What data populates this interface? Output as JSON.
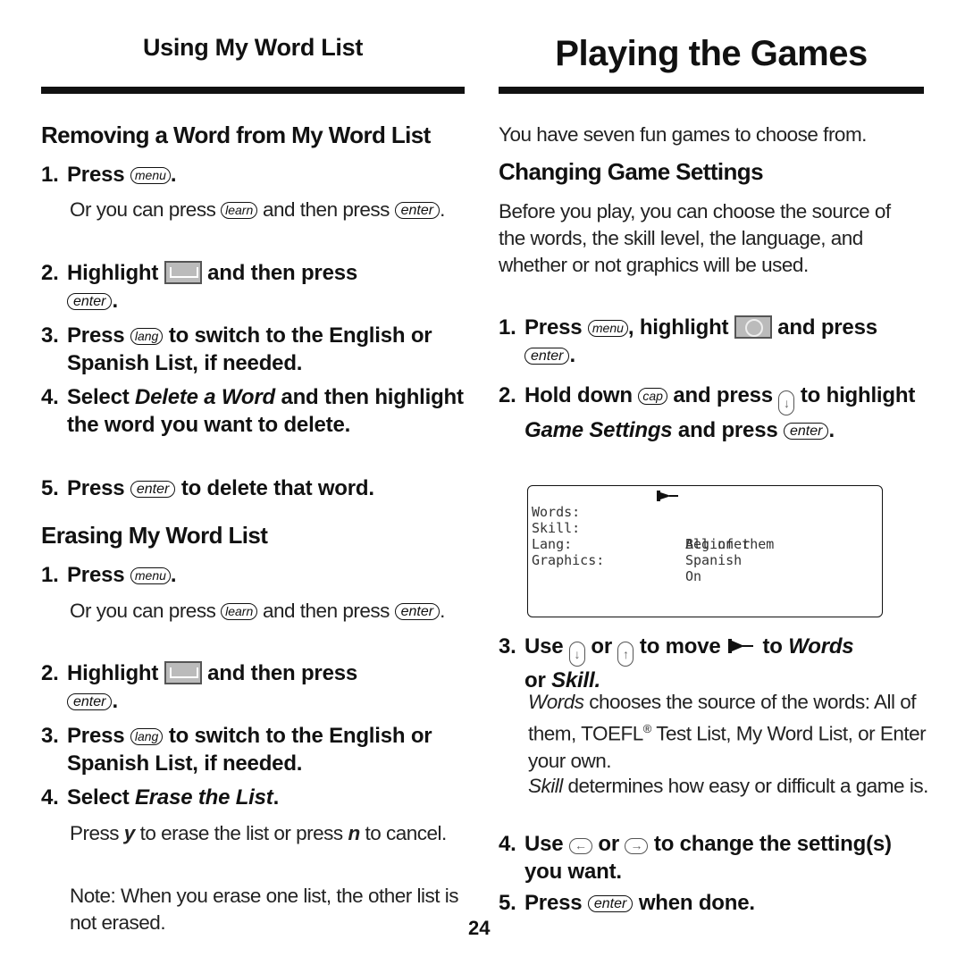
{
  "left": {
    "header": "Using My Word List",
    "section1": {
      "title": "Removing a Word from My Word List",
      "steps": [
        {
          "num": "1.",
          "pre": "Press",
          "key": "menu",
          "post": "."
        },
        {
          "note_pre": "Or you can press",
          "note_key": "learn",
          "note_mid": "and then press",
          "note_key2": "enter",
          "note_post": "."
        },
        {
          "num": "2.",
          "pre": "Highlight",
          "icon": "word-list-icon",
          "mid": "and then press",
          "key": "enter",
          "post": "."
        },
        {
          "num": "3.",
          "pre": "Press",
          "key": "lang",
          "post": "to switch to the English or Spanish List, if needed."
        },
        {
          "num": "4.",
          "pre": "Select",
          "em": "Delete a Word",
          "post": "and then highlight the word you want to delete."
        },
        {
          "num": "5.",
          "pre": "Press",
          "key": "enter",
          "post": "to delete that word."
        }
      ]
    },
    "section2": {
      "title": "Erasing My Word List",
      "steps": [
        {
          "num": "1.",
          "pre": "Press",
          "key": "menu",
          "post": "."
        },
        {
          "note_pre": "Or you can press",
          "note_key": "learn",
          "note_mid": "and then press",
          "note_key2": "enter",
          "note_post": "."
        },
        {
          "num": "2.",
          "pre": "Highlight",
          "icon": "word-list-icon",
          "mid": "and then press",
          "key": "enter",
          "post": "."
        },
        {
          "num": "3.",
          "pre": "Press",
          "key": "lang",
          "post": "to switch to the English or Spanish List, if needed."
        },
        {
          "num": "4.",
          "pre": "Select",
          "em": "Erase the List",
          "post": "."
        }
      ],
      "note1": {
        "pre": "Press",
        "y": "y",
        "mid": "to erase the list or press",
        "n": "n",
        "post": "to cancel."
      },
      "note2": "Note: When you erase one list, the other list is not erased."
    }
  },
  "right": {
    "header": "Playing the Games",
    "intro": "You have seven fun games to choose from.",
    "section": {
      "title": "Changing Game Settings",
      "body": "Before you play, you can choose the source of the words, the skill level, the language, and whether or not graphics will be used.",
      "steps": [
        {
          "num": "1.",
          "pre": "Press",
          "key": "menu",
          "mid": ", highlight",
          "icon": "games-icon",
          "mid2": "and press",
          "key2": "enter",
          "post": "."
        },
        {
          "num": "2.",
          "pre": "Hold down",
          "key": "cap",
          "mid": "and press",
          "arrow": "down",
          "mid2": "to highlight",
          "em": "Game Settings",
          "mid3": "and press",
          "key2": "enter",
          "post": "."
        },
        {
          "num": "3.",
          "pre": "Use",
          "arrow": "down",
          "or": "or",
          "arrow2": "up",
          "mid": "to move",
          "mid2": "to",
          "em": "Words",
          "or2": "or",
          "em2": "Skill."
        },
        {
          "num": "4.",
          "pre": "Use",
          "arrow": "left",
          "or": "or",
          "arrow2": "right",
          "post": "to change the setting(s) you want."
        },
        {
          "num": "5.",
          "pre": "Press",
          "key": "enter",
          "post": "when done."
        }
      ],
      "words_desc": {
        "em": "Words",
        "text": "chooses the source of the words: All of them, TOEFL",
        "reg": "®",
        "text2": "Test List, My Word List, or Enter your own."
      },
      "skill_desc": {
        "em": "Skill",
        "text": "determines how easy or difficult a game is."
      }
    },
    "screen": {
      "rows": [
        {
          "label": "Words:",
          "value": "All of them",
          "selected": true
        },
        {
          "label": "Skill:",
          "value": "Beginner"
        },
        {
          "label": "Lang:",
          "value": "Spanish"
        },
        {
          "label": "Graphics:",
          "value": "On"
        }
      ]
    }
  },
  "page_number": "24"
}
